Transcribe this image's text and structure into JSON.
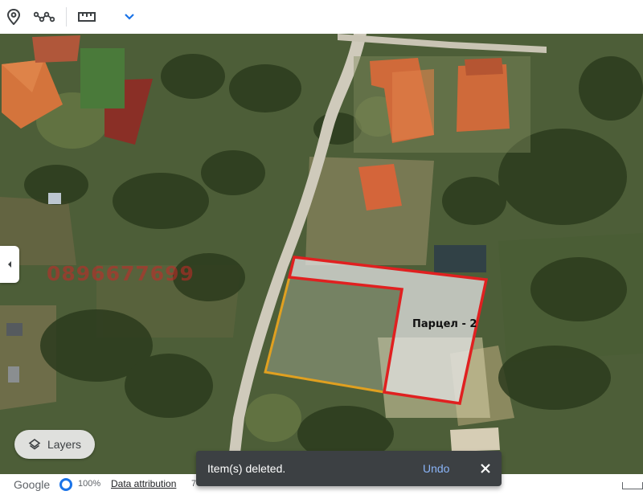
{
  "toolbar": {
    "icons": [
      "map-pin-icon",
      "path-icon",
      "ruler-icon",
      "chevron-down-icon"
    ]
  },
  "map": {
    "watermark": "0896677699",
    "parcel_label": "Парцел - 2",
    "colors": {
      "parcel_outline": "#e02020",
      "boundary_outline": "#e0a020"
    }
  },
  "layers": {
    "label": "Layers"
  },
  "footer": {
    "logo": "Google",
    "zoom": "100%",
    "attribution": "Data attribution",
    "attribution_more": "7"
  },
  "snackbar": {
    "message": "Item(s) deleted.",
    "undo": "Undo"
  }
}
